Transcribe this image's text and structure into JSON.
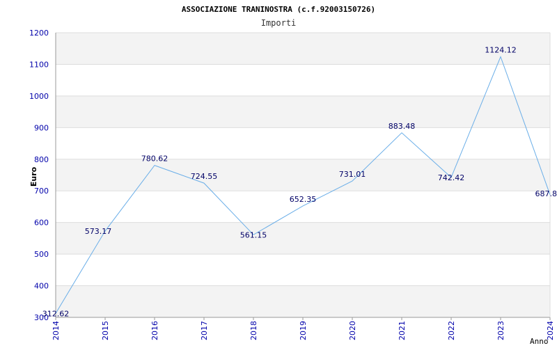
{
  "colors": {
    "line": "#6aaee8",
    "band": "#f3f3f3",
    "grid": "#dddddd",
    "axis": "#999999",
    "tick_text": "#0000aa",
    "data_label": "#000066"
  },
  "chart_data": {
    "type": "line",
    "title": "ASSOCIAZIONE TRANINOSTRA (c.f.92003150726)",
    "subtitle": "Importi",
    "xlabel": "Anno",
    "ylabel": "Euro",
    "ylim": [
      300,
      1200
    ],
    "yticks": [
      300,
      400,
      500,
      600,
      700,
      800,
      900,
      1000,
      1100,
      1200
    ],
    "grid": true,
    "legend": "none",
    "x": [
      "2014",
      "2015",
      "2016",
      "2017",
      "2018",
      "2019",
      "2020",
      "2021",
      "2022",
      "2023",
      "2024"
    ],
    "series": [
      {
        "values": [
          312.62,
          573.17,
          780.62,
          724.55,
          561.15,
          652.35,
          731.01,
          883.48,
          742.42,
          1124.12,
          687.8
        ],
        "labels": [
          "312.62",
          "573.17",
          "780.62",
          "724.55",
          "561.15",
          "652.35",
          "731.01",
          "883.48",
          "742.42",
          "1124.12",
          "687.8"
        ]
      }
    ]
  }
}
